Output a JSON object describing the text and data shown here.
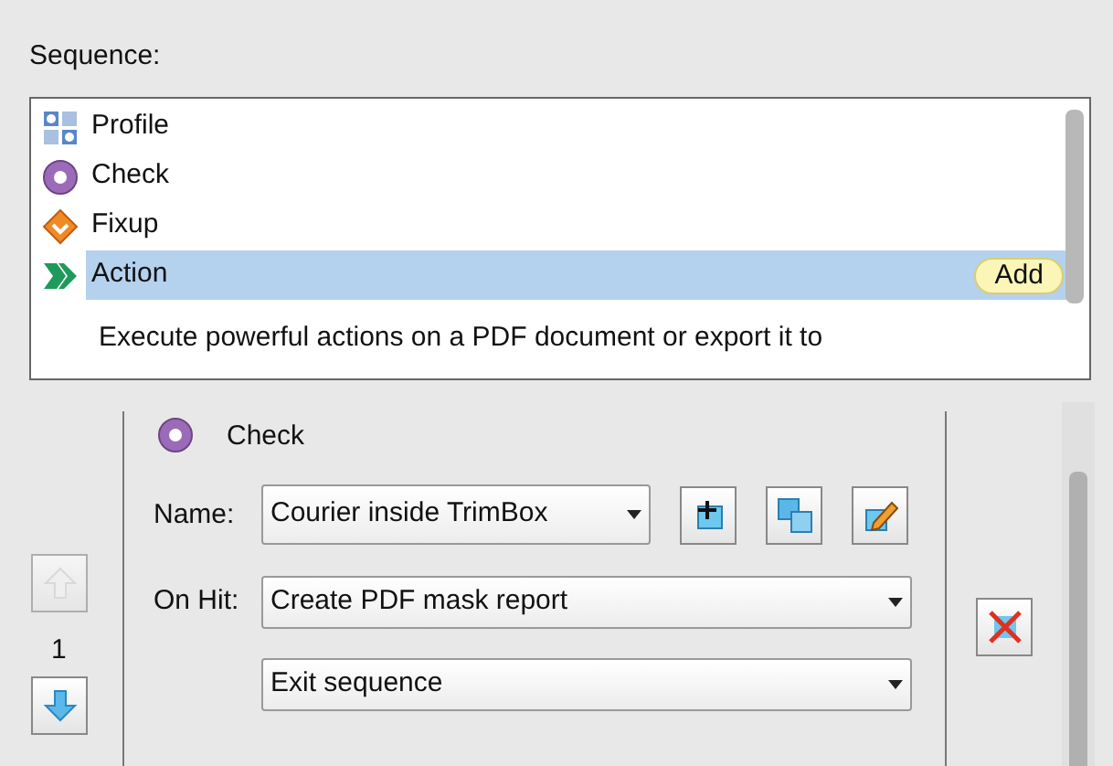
{
  "sequence_label": "Sequence:",
  "items": [
    {
      "kind": "profile",
      "label": "Profile",
      "selected": false
    },
    {
      "kind": "check",
      "label": "Check",
      "selected": false
    },
    {
      "kind": "fixup",
      "label": "Fixup",
      "selected": false
    },
    {
      "kind": "action",
      "label": "Action",
      "selected": true
    }
  ],
  "add_button": "Add",
  "description": "Execute powerful actions on a PDF document or export it to",
  "step": {
    "kind": "check",
    "title": "Check",
    "name_label": "Name:",
    "name_value": "Courier inside TrimBox",
    "on_hit_label": "On Hit:",
    "on_hit_value": "Create PDF mask report",
    "next_value": "Exit sequence",
    "number": "1",
    "up_disabled": true,
    "down_disabled": false
  }
}
